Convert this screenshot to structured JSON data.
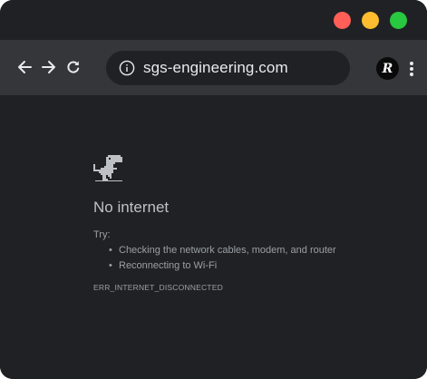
{
  "window": {
    "controls": {
      "close_color": "#ff5f57",
      "minimize_color": "#febc2e",
      "zoom_color": "#28c840"
    }
  },
  "toolbar": {
    "back_icon": "arrow-left-icon",
    "forward_icon": "arrow-right-icon",
    "reload_icon": "reload-icon",
    "url": "sgs-engineering.com",
    "site_info_icon": "info-icon",
    "profile_initial": "R",
    "menu_icon": "more-vert-icon"
  },
  "error_page": {
    "icon": "dino-icon",
    "title": "No internet",
    "try_label": "Try:",
    "suggestions": [
      "Checking the network cables, modem, and router",
      "Reconnecting to Wi-Fi"
    ],
    "bullet": "•",
    "error_code": "ERR_INTERNET_DISCONNECTED"
  },
  "colors": {
    "background": "#202124",
    "toolbar": "#35363a",
    "text_primary": "#bdc1c6",
    "text_secondary": "#9aa0a6"
  }
}
